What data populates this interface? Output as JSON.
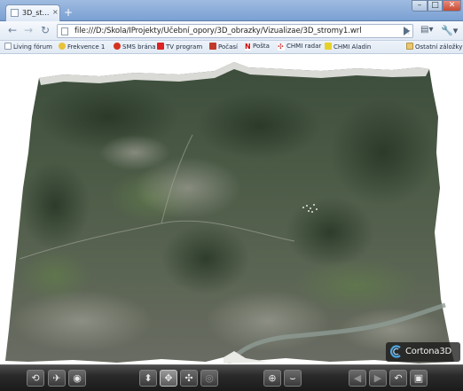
{
  "window": {
    "tab_title": "3D_st…",
    "tab_close": "×",
    "new_tab": "+",
    "min": "–",
    "max": "□",
    "close": "✕"
  },
  "toolbar": {
    "back": "←",
    "forward": "→",
    "reload": "↻",
    "url": "file:///D:/Skola/IProjekty/Učební_opory/3D_obrazky/Vizualizae/3D_stromy1.wrl",
    "star": "☆",
    "page_menu": "▤▾",
    "wrench_menu": "🔧▾"
  },
  "bookmarks": {
    "items": [
      {
        "label": "Living fórum"
      },
      {
        "label": "Frekvence 1"
      },
      {
        "label": "SMS brána"
      },
      {
        "label": "TV program"
      },
      {
        "label": "Počasí"
      },
      {
        "label": "Pošta"
      },
      {
        "label": "CHMI radar"
      },
      {
        "label": "CHMI Aladin"
      }
    ],
    "other_label": "Ostatní záložky",
    "more": "»"
  },
  "viewer": {
    "logo_text": "Cortona3D"
  },
  "nav_buttons": {
    "restore_icon": "restore-view-icon",
    "fly_icon": "fly-icon",
    "study_icon": "study-icon",
    "walk_icon": "walk-icon",
    "pan_icon": "pan-icon",
    "turn_icon": "turn-icon",
    "roll_icon": "roll-icon",
    "goto_icon": "goto-icon",
    "align_icon": "align-icon",
    "prev_icon": "prev-view-icon",
    "next_icon": "next-view-icon",
    "undo_icon": "undo-icon",
    "fit_icon": "fit-icon"
  }
}
